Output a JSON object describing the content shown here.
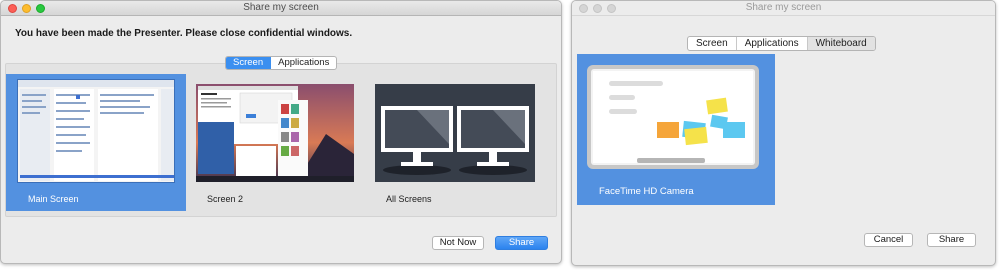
{
  "left_window": {
    "title": "Share my screen",
    "message": "You have been made the Presenter. Please close confidential windows.",
    "tabs": [
      {
        "label": "Screen",
        "active": true
      },
      {
        "label": "Applications",
        "active": false
      }
    ],
    "tiles": [
      {
        "label": "Main Screen",
        "selected": true
      },
      {
        "label": "Screen 2",
        "selected": false
      },
      {
        "label": "All Screens",
        "selected": false
      }
    ],
    "buttons": {
      "not_now": "Not Now",
      "share": "Share"
    }
  },
  "right_window": {
    "title": "Share my screen",
    "tabs": [
      {
        "label": "Screen",
        "active": false
      },
      {
        "label": "Applications",
        "active": false
      },
      {
        "label": "Whiteboard",
        "active": true
      }
    ],
    "tiles": [
      {
        "label": "FaceTime HD Camera",
        "selected": true
      }
    ],
    "buttons": {
      "cancel": "Cancel",
      "share": "Share"
    }
  },
  "colors": {
    "accent": "#3b8ff0",
    "selection": "#5391e0",
    "close": "#fc5f57",
    "minimize": "#fdbc2e",
    "maximize": "#29c840",
    "sticky_yellow": "#f5e24a",
    "sticky_orange": "#f5a53a",
    "sticky_blue": "#5cc8f0"
  }
}
